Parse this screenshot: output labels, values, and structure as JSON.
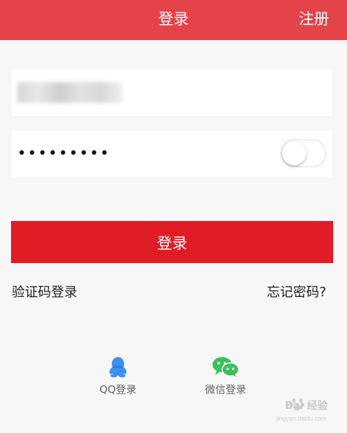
{
  "header": {
    "title": "登录",
    "register_label": "注册",
    "bg_color": "#e5434a"
  },
  "form": {
    "username_value": "",
    "password_value": "•••••••••",
    "show_password_toggle": "off",
    "login_button_label": "登录",
    "login_button_color": "#e01c26"
  },
  "links": {
    "sms_login": "验证码登录",
    "forgot_password": "忘记密码?"
  },
  "social": {
    "qq": {
      "label": "QQ登录",
      "icon": "qq-penguin-icon",
      "color": "#3d8ff3"
    },
    "wechat": {
      "label": "微信登录",
      "icon": "wechat-icon",
      "color": "#3dbf5e"
    }
  },
  "watermark": {
    "text": "Bai 经验",
    "url_text": "jingyan.baidu.com"
  }
}
